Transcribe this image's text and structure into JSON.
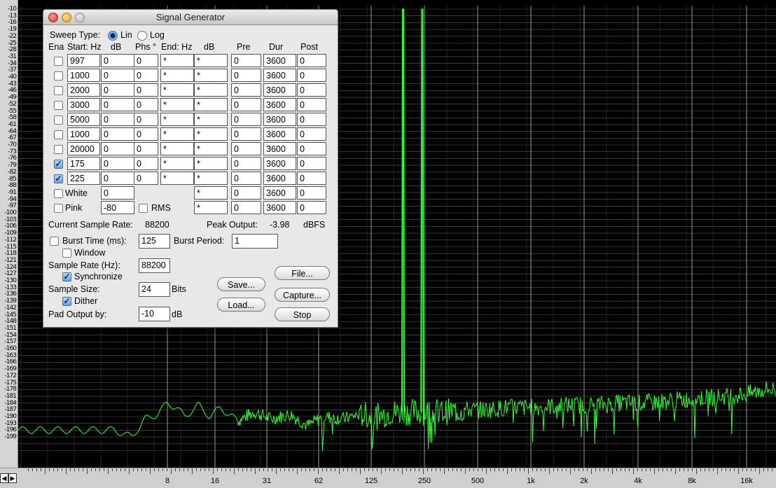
{
  "window": {
    "title": "Signal Generator"
  },
  "sweep": {
    "label": "Sweep Type:",
    "options": [
      "Lin",
      "Log"
    ],
    "selected": "Lin"
  },
  "columns": {
    "ena": "Ena",
    "start": "Start: Hz",
    "db": "dB",
    "phs": "Phs °",
    "end": "End: Hz",
    "db2": "dB",
    "pre": "Pre",
    "dur": "Dur",
    "post": "Post"
  },
  "rows": [
    {
      "enabled": false,
      "start": "997",
      "db": "0",
      "phs": "0",
      "end": "*",
      "db2": "*",
      "pre": "0",
      "dur": "3600",
      "post": "0"
    },
    {
      "enabled": false,
      "start": "1000",
      "db": "0",
      "phs": "0",
      "end": "*",
      "db2": "*",
      "pre": "0",
      "dur": "3600",
      "post": "0"
    },
    {
      "enabled": false,
      "start": "2000",
      "db": "0",
      "phs": "0",
      "end": "*",
      "db2": "*",
      "pre": "0",
      "dur": "3600",
      "post": "0"
    },
    {
      "enabled": false,
      "start": "3000",
      "db": "0",
      "phs": "0",
      "end": "*",
      "db2": "*",
      "pre": "0",
      "dur": "3600",
      "post": "0"
    },
    {
      "enabled": false,
      "start": "5000",
      "db": "0",
      "phs": "0",
      "end": "*",
      "db2": "*",
      "pre": "0",
      "dur": "3600",
      "post": "0"
    },
    {
      "enabled": false,
      "start": "1000",
      "db": "0",
      "phs": "0",
      "end": "*",
      "db2": "*",
      "pre": "0",
      "dur": "3600",
      "post": "0"
    },
    {
      "enabled": false,
      "start": "20000",
      "db": "0",
      "phs": "0",
      "end": "*",
      "db2": "*",
      "pre": "0",
      "dur": "3600",
      "post": "0"
    },
    {
      "enabled": true,
      "start": "175",
      "db": "0",
      "phs": "0",
      "end": "*",
      "db2": "*",
      "pre": "0",
      "dur": "3600",
      "post": "0"
    },
    {
      "enabled": true,
      "start": "225",
      "db": "0",
      "phs": "0",
      "end": "*",
      "db2": "*",
      "pre": "0",
      "dur": "3600",
      "post": "0"
    }
  ],
  "white": {
    "label": "White",
    "enabled": false,
    "db": "0",
    "db2": "*",
    "pre": "0",
    "dur": "3600",
    "post": "0"
  },
  "pink": {
    "label": "Pink",
    "enabled": false,
    "db": "-80",
    "rms_label": "RMS",
    "rms": false,
    "db2": "*",
    "pre": "0",
    "dur": "3600",
    "post": "0"
  },
  "status": {
    "current_rate_label": "Current Sample Rate:",
    "current_rate": "88200",
    "peak_label": "Peak Output:",
    "peak": "-3.98",
    "peak_unit": "dBFS"
  },
  "burst": {
    "label": "Burst Time (ms):",
    "enabled": false,
    "time": "125",
    "period_label": "Burst Period:",
    "period": "1",
    "window_label": "Window",
    "window": false
  },
  "sample_rate": {
    "label": "Sample Rate (Hz):",
    "value": "88200",
    "sync_label": "Synchronize",
    "sync": true
  },
  "sample_size": {
    "label": "Sample Size:",
    "value": "24",
    "unit": "Bits",
    "dither_label": "Dither",
    "dither": true
  },
  "pad": {
    "label": "Pad Output by:",
    "value": "-10",
    "unit": "dB"
  },
  "buttons": {
    "save": "Save...",
    "load": "Load...",
    "file": "File...",
    "capture": "Capture...",
    "stop": "Stop"
  },
  "yaxis": {
    "labels": [
      "-10",
      "-13",
      "-16",
      "-19",
      "-22",
      "-25",
      "-28",
      "-31",
      "-34",
      "-37",
      "-40",
      "-43",
      "-46",
      "-49",
      "-52",
      "-55",
      "-58",
      "-61",
      "-64",
      "-67",
      "-70",
      "-73",
      "-76",
      "-79",
      "-82",
      "-85",
      "-88",
      "-91",
      "-94",
      "-97",
      "-100",
      "-103",
      "-106",
      "-109",
      "-112",
      "-115",
      "-118",
      "-121",
      "-124",
      "-127",
      "-130",
      "-133",
      "-136",
      "-139",
      "-142",
      "-145",
      "-148",
      "-151",
      "-154",
      "-157",
      "-160",
      "-163",
      "-166",
      "-169",
      "-172",
      "-175",
      "-178",
      "-181",
      "-184",
      "-187",
      "-190",
      "-193",
      "-196",
      "-199"
    ]
  },
  "xaxis": {
    "labels": [
      "8",
      "16",
      "31",
      "62",
      "125",
      "250",
      "500",
      "1k",
      "2k",
      "4k",
      "8k",
      "16k"
    ]
  },
  "scroll": {
    "left": "◀",
    "right": "▶"
  },
  "chart_data": {
    "type": "line",
    "x_scale": "log",
    "ylim": [
      -200,
      -9
    ],
    "grid": true,
    "color": "#33ff33",
    "series": [
      {
        "x": [
          4,
          5,
          6,
          7,
          8,
          9,
          10,
          12,
          14,
          16,
          20,
          25,
          31,
          40,
          50,
          62,
          80,
          100,
          125,
          150,
          175,
          200,
          225,
          250,
          300,
          400,
          500,
          700,
          1000,
          1500,
          2000,
          3000,
          4000,
          6000,
          8000,
          12000,
          16000,
          20000
        ],
        "values": [
          -196,
          -199,
          -191,
          -189,
          -184,
          -186,
          -190,
          -185,
          -190,
          -186,
          -192,
          -188,
          -191,
          -189,
          -194,
          -190,
          -191,
          -189,
          -190,
          -188,
          -10,
          -188,
          -10,
          -188,
          -188,
          -187,
          -187,
          -186,
          -186,
          -185,
          -185,
          -184,
          -184,
          -183,
          -182,
          -181,
          -180,
          -178
        ]
      }
    ]
  }
}
